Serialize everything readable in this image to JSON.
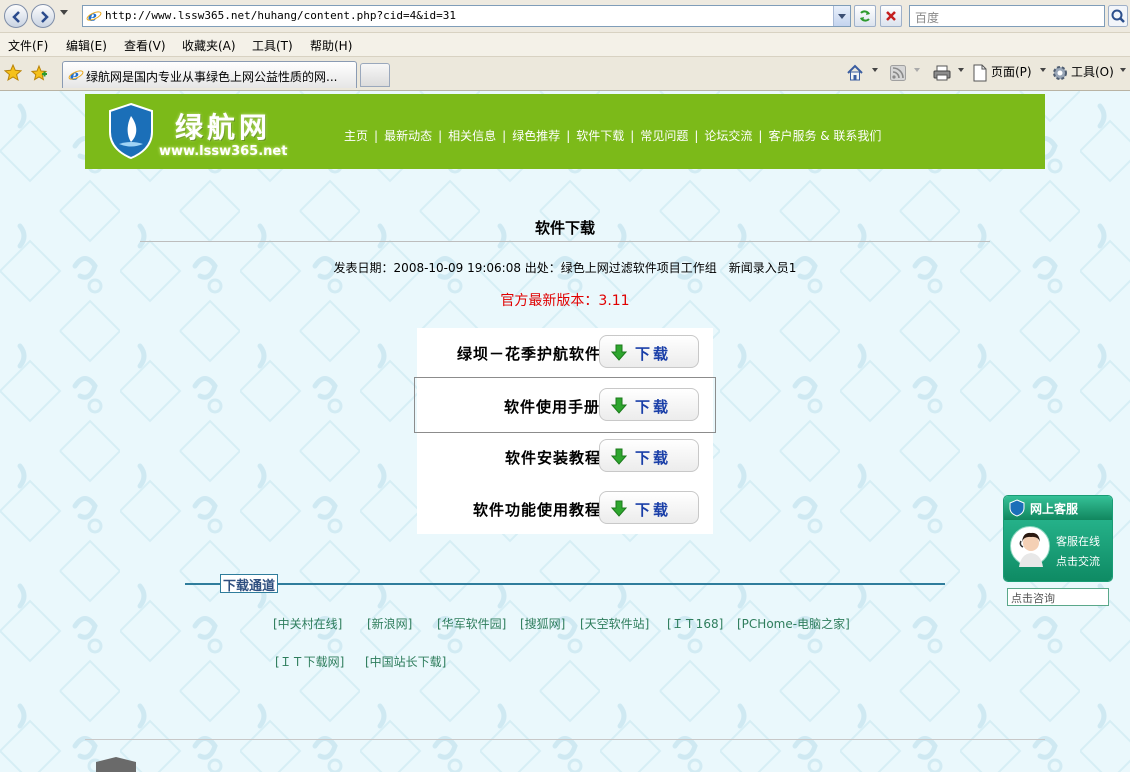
{
  "browser": {
    "url": "http://www.lssw365.net/huhang/content.php?cid=4&id=31",
    "search_placeholder": "百度",
    "menu": [
      "文件(F)",
      "编辑(E)",
      "查看(V)",
      "收藏夹(A)",
      "工具(T)",
      "帮助(H)"
    ],
    "tab_title": "绿航网是国内专业从事绿色上网公益性质的网...",
    "toolbar": {
      "page": "页面(P)",
      "tools": "工具(O)"
    }
  },
  "site": {
    "logo_text": "绿航网",
    "logo_url": "www.lssw365.net",
    "nav": [
      "主页",
      "最新动态",
      "相关信息",
      "绿色推荐",
      "软件下载",
      "常见问题",
      "论坛交流",
      "客户服务 & 联系我们"
    ]
  },
  "article": {
    "title": "软件下载",
    "meta": "发表日期：2008-10-09 19:06:08 出处：绿色上网过滤软件项目工作组　新闻录入员1",
    "version": "官方最新版本：3.11"
  },
  "downloads": [
    {
      "label": "绿坝－花季护航软件",
      "button": "下载"
    },
    {
      "label": "软件使用手册",
      "button": "下载"
    },
    {
      "label": "软件安装教程",
      "button": "下载"
    },
    {
      "label": "软件功能使用教程",
      "button": "下载"
    }
  ],
  "channels": {
    "title": "下载通道",
    "row1": [
      "[中关村在线]",
      "[新浪网]",
      "[华军软件园]",
      "[搜狐网]",
      "[天空软件站]",
      "[ＩＴ168]",
      "[PCHome-电脑之家]"
    ],
    "row2": [
      "[ＩＴ下载网]",
      "[中国站长下载]"
    ]
  },
  "service": {
    "header": "网上客服",
    "line1": "客服在线",
    "line2": "点击交流",
    "input": "点击咨询"
  }
}
